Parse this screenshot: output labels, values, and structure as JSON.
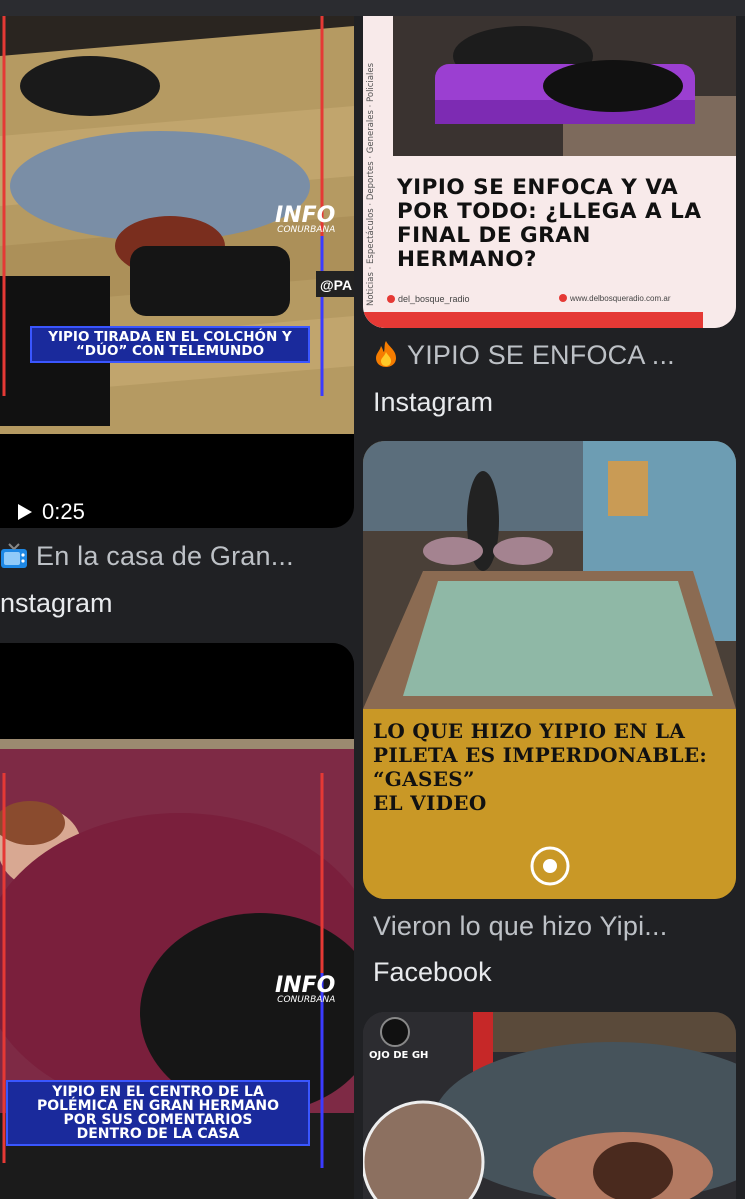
{
  "left_column": {
    "card1": {
      "caption_line1": "YIPIO TIRADA EN EL COLCHÓN Y",
      "caption_line2": "“DÚO” CON TELEMUNDO",
      "logo_main": "INFO",
      "logo_sub": "CONURBANA",
      "handle": "@PA",
      "duration": "0:25"
    },
    "card1_title": "En la casa de Gran...",
    "card1_title_icon": "tv-icon",
    "card1_source": "nstagram",
    "card2": {
      "caption_line1": "YIPIO EN EL CENTRO DE LA",
      "caption_line2": "POLÉMICA EN GRAN HERMANO",
      "caption_line3": "POR SUS COMENTARIOS",
      "caption_line4": "DENTRO DE LA CASA",
      "logo_main": "INFO",
      "logo_sub": "CONURBANA"
    }
  },
  "right_column": {
    "card1": {
      "headline_line1": "YIPIO SE ENFOCA Y VA",
      "headline_line2": "POR TODO: ¿LLEGA A LA",
      "headline_line3": "FINAL DE GRAN",
      "headline_line4": "HERMANO?",
      "side_text": "Noticias · Espectáculos · Deportes · Generales · Policiales",
      "footer_left": "del_bosque_radio",
      "footer_right": "www.delbosqueradio.com.ar"
    },
    "card1_title": "YIPIO SE ENFOCA ...",
    "card1_title_icon": "fire-icon",
    "card1_source": "Instagram",
    "card2": {
      "headline_line1": "LO QUE HIZO YIPIO EN LA",
      "headline_line2": "PILETA ES IMPERDONABLE:",
      "headline_line3": "“GASES”",
      "headline_line4": "EL VIDEO"
    },
    "card2_title": "Vieron lo que hizo Yipi...",
    "card2_source": "Facebook",
    "card3": {
      "logo_text": "OJO DE GH"
    }
  },
  "colors": {
    "background": "#202124",
    "title_text": "#bdc1c6",
    "source_text": "#e8eaed",
    "caption_blue": "#1a2a9c",
    "accent_red": "#e53935"
  }
}
